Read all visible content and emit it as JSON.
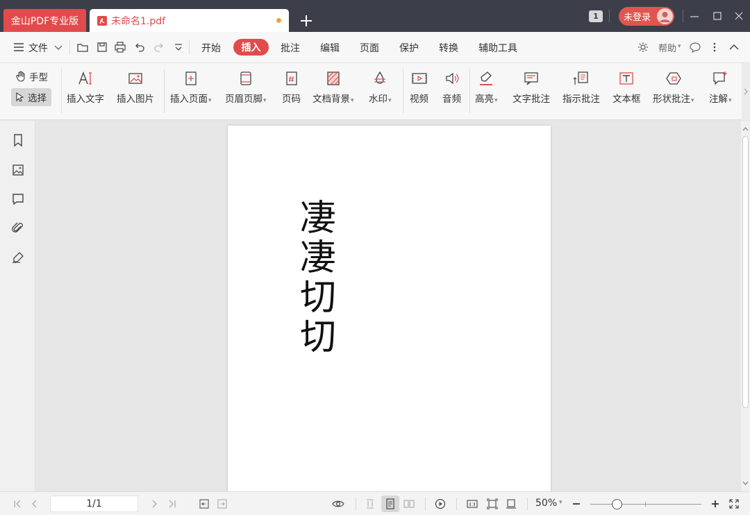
{
  "window": {
    "app_tab_label": "金山PDF专业版",
    "doc_tab_label": "未命名1.pdf",
    "badge_count": "1",
    "login_label": "未登录"
  },
  "menu": {
    "file_label": "文件",
    "tabs": [
      "开始",
      "插入",
      "批注",
      "编辑",
      "页面",
      "保护",
      "转换",
      "辅助工具"
    ],
    "active_tab": "插入",
    "help_label": "帮助"
  },
  "ribbon": {
    "hand_label": "手型",
    "select_label": "选择",
    "buttons": [
      {
        "label": "插入文字",
        "icon": "insert-text-icon",
        "dropdown": false
      },
      {
        "label": "插入图片",
        "icon": "insert-image-icon",
        "dropdown": false
      },
      {
        "label": "插入页面",
        "icon": "insert-page-icon",
        "dropdown": true
      },
      {
        "label": "页眉页脚",
        "icon": "header-footer-icon",
        "dropdown": true
      },
      {
        "label": "页码",
        "icon": "page-number-icon",
        "dropdown": false
      },
      {
        "label": "文档背景",
        "icon": "background-icon",
        "dropdown": true
      },
      {
        "label": "水印",
        "icon": "watermark-icon",
        "dropdown": true
      },
      {
        "label": "视频",
        "icon": "video-icon",
        "dropdown": false
      },
      {
        "label": "音频",
        "icon": "audio-icon",
        "dropdown": false
      },
      {
        "label": "高亮",
        "icon": "highlight-icon",
        "dropdown": true
      },
      {
        "label": "文字批注",
        "icon": "text-comment-icon",
        "dropdown": false
      },
      {
        "label": "指示批注",
        "icon": "pointer-comment-icon",
        "dropdown": false
      },
      {
        "label": "文本框",
        "icon": "textbox-icon",
        "dropdown": false
      },
      {
        "label": "形状批注",
        "icon": "shape-comment-icon",
        "dropdown": true
      },
      {
        "label": "注解",
        "icon": "annotation-icon",
        "dropdown": true
      }
    ]
  },
  "document": {
    "vertical_text": [
      "凄",
      "凄",
      "切",
      "切"
    ]
  },
  "statusbar": {
    "page_indicator": "1/1",
    "zoom_label": "50%",
    "zoom_fraction": 0.25
  },
  "colors": {
    "accent": "#e24b4b",
    "titlebar": "#3c3f4a",
    "toolbar_bg": "#f7f7f7",
    "canvas_bg": "#e6e6e6"
  }
}
